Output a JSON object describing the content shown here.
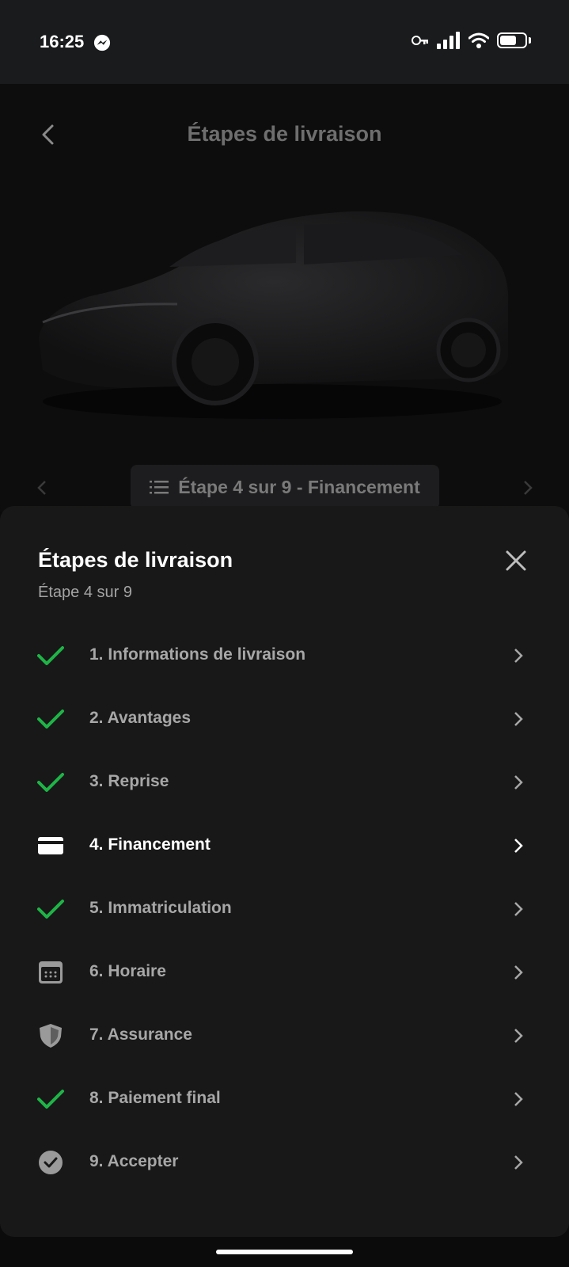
{
  "status": {
    "time": "16:25"
  },
  "header": {
    "title": "Étapes de livraison",
    "step_pill": "Étape 4 sur 9 - Financement"
  },
  "sheet": {
    "title": "Étapes de livraison",
    "subtitle": "Étape 4 sur 9",
    "steps": [
      {
        "label": "1. Informations de livraison",
        "icon": "check-icon",
        "status": "done"
      },
      {
        "label": "2. Avantages",
        "icon": "check-icon",
        "status": "done"
      },
      {
        "label": "3. Reprise",
        "icon": "check-icon",
        "status": "done"
      },
      {
        "label": "4. Financement",
        "icon": "card-icon",
        "status": "current"
      },
      {
        "label": "5. Immatriculation",
        "icon": "check-icon",
        "status": "done"
      },
      {
        "label": "6. Horaire",
        "icon": "calendar-icon",
        "status": "pending"
      },
      {
        "label": "7. Assurance",
        "icon": "shield-icon",
        "status": "pending"
      },
      {
        "label": "8. Paiement final",
        "icon": "check-icon",
        "status": "done"
      },
      {
        "label": "9. Accepter",
        "icon": "circle-check-icon",
        "status": "pending"
      }
    ]
  },
  "colors": {
    "check": "#1fb447",
    "sheet_bg": "#181818",
    "muted_text": "#a7a7a7"
  }
}
